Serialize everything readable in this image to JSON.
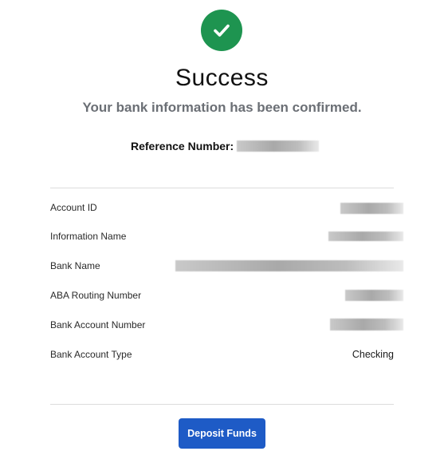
{
  "header": {
    "status_icon": "check-icon",
    "status_color": "#1e9450",
    "title": "Success",
    "subtitle": "Your bank information has been confirmed."
  },
  "reference": {
    "label": "Reference Number:",
    "value_redacted": true
  },
  "details": [
    {
      "label": "Account ID",
      "value": "",
      "redacted": true
    },
    {
      "label": "Information Name",
      "value": "",
      "redacted": true
    },
    {
      "label": "Bank Name",
      "value": "",
      "redacted": true
    },
    {
      "label": "ABA Routing Number",
      "value": "",
      "redacted": true
    },
    {
      "label": "Bank Account Number",
      "value": "",
      "redacted": true
    },
    {
      "label": "Bank Account Type",
      "value": "Checking",
      "redacted": false
    }
  ],
  "actions": {
    "deposit_label": "Deposit Funds",
    "button_color": "#1e5bc6"
  }
}
